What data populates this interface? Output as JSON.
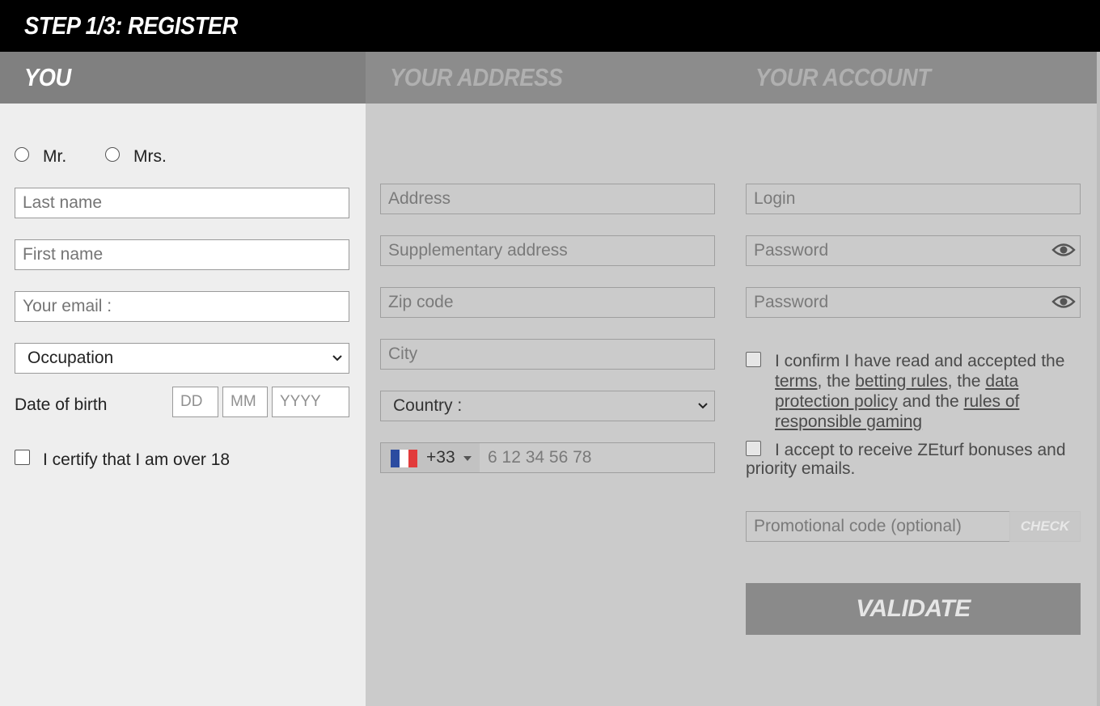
{
  "header": {
    "title": "STEP 1/3: REGISTER"
  },
  "tabs": {
    "you": "YOU",
    "address": "YOUR ADDRESS",
    "account": "YOUR ACCOUNT"
  },
  "you": {
    "mr_label": "Mr.",
    "mrs_label": "Mrs.",
    "last_name_placeholder": "Last name",
    "first_name_placeholder": "First name",
    "email_placeholder": "Your email :",
    "occupation_value": "Occupation",
    "dob_label": "Date of birth",
    "dob_day_placeholder": "DD",
    "dob_month_placeholder": "MM",
    "dob_year_placeholder": "YYYY",
    "over18_label": "I certify that I am over 18"
  },
  "address": {
    "address_placeholder": "Address",
    "supplementary_placeholder": "Supplementary address",
    "zip_placeholder": "Zip code",
    "city_placeholder": "City",
    "country_value": "Country :",
    "phone_dial_code": "+33",
    "phone_placeholder": "6 12 34 56 78"
  },
  "account": {
    "login_placeholder": "Login",
    "password_placeholder": "Password",
    "password_confirm_placeholder": "Password",
    "terms_text_1": "I confirm I have read and accepted the ",
    "terms_link": "terms",
    "terms_text_2": ", the ",
    "betting_rules_link": "betting rules",
    "terms_text_3": ", the ",
    "data_protection_link": "data protection policy",
    "terms_text_4": " and the ",
    "responsible_gaming_link": "rules of responsible gaming",
    "bonus_text": "I accept to receive ZEturf bonuses and priority emails.",
    "promo_placeholder": "Promotional code (optional)",
    "check_label": "CHECK",
    "validate_label": "VALIDATE"
  },
  "colors": {
    "flag_blue": "#2b4ba0",
    "flag_white": "#ffffff",
    "flag_red": "#e23b3b"
  }
}
